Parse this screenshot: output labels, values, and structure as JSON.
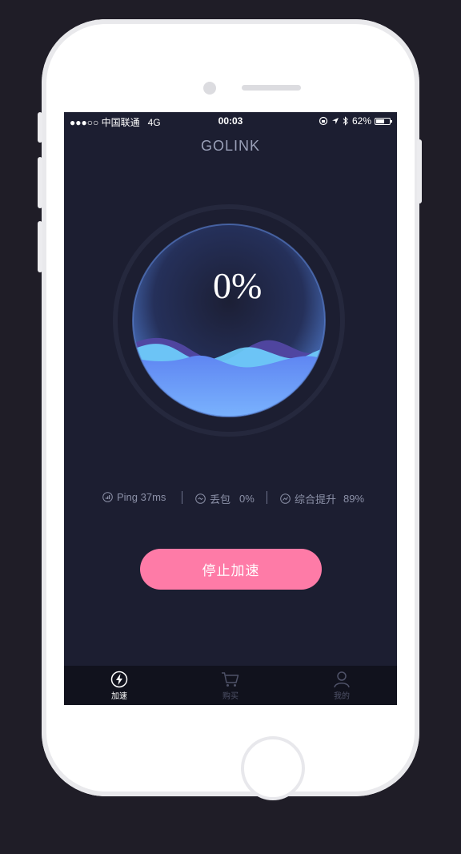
{
  "status_bar": {
    "carrier": "●●●○○ 中国联通",
    "network": "4G",
    "time": "00:03",
    "battery_percent": "62%",
    "battery_level": 0.62
  },
  "app": {
    "title": "GOLINK"
  },
  "gauge": {
    "value_text": "0%",
    "ring_color": "#2a2d44",
    "wave_color_light": "#6fd1ff",
    "wave_color_dark": "#5a4fa8",
    "fill_color": "#6a9bff"
  },
  "stats": {
    "ping": {
      "icon": "signal-icon",
      "label": "Ping 37ms"
    },
    "packet_loss": {
      "icon": "packet-icon",
      "label": "丢包",
      "value": "0%"
    },
    "boost": {
      "icon": "trend-icon",
      "label": "综合提升",
      "value": "89%"
    }
  },
  "action": {
    "stop_label": "停止加速",
    "accent": "#fe7ba7"
  },
  "tabbar": {
    "tabs": [
      {
        "icon": "lightning-icon",
        "label": "加速",
        "active": true
      },
      {
        "icon": "cart-icon",
        "label": "购买",
        "active": false
      },
      {
        "icon": "user-icon",
        "label": "我的",
        "active": false
      }
    ]
  }
}
